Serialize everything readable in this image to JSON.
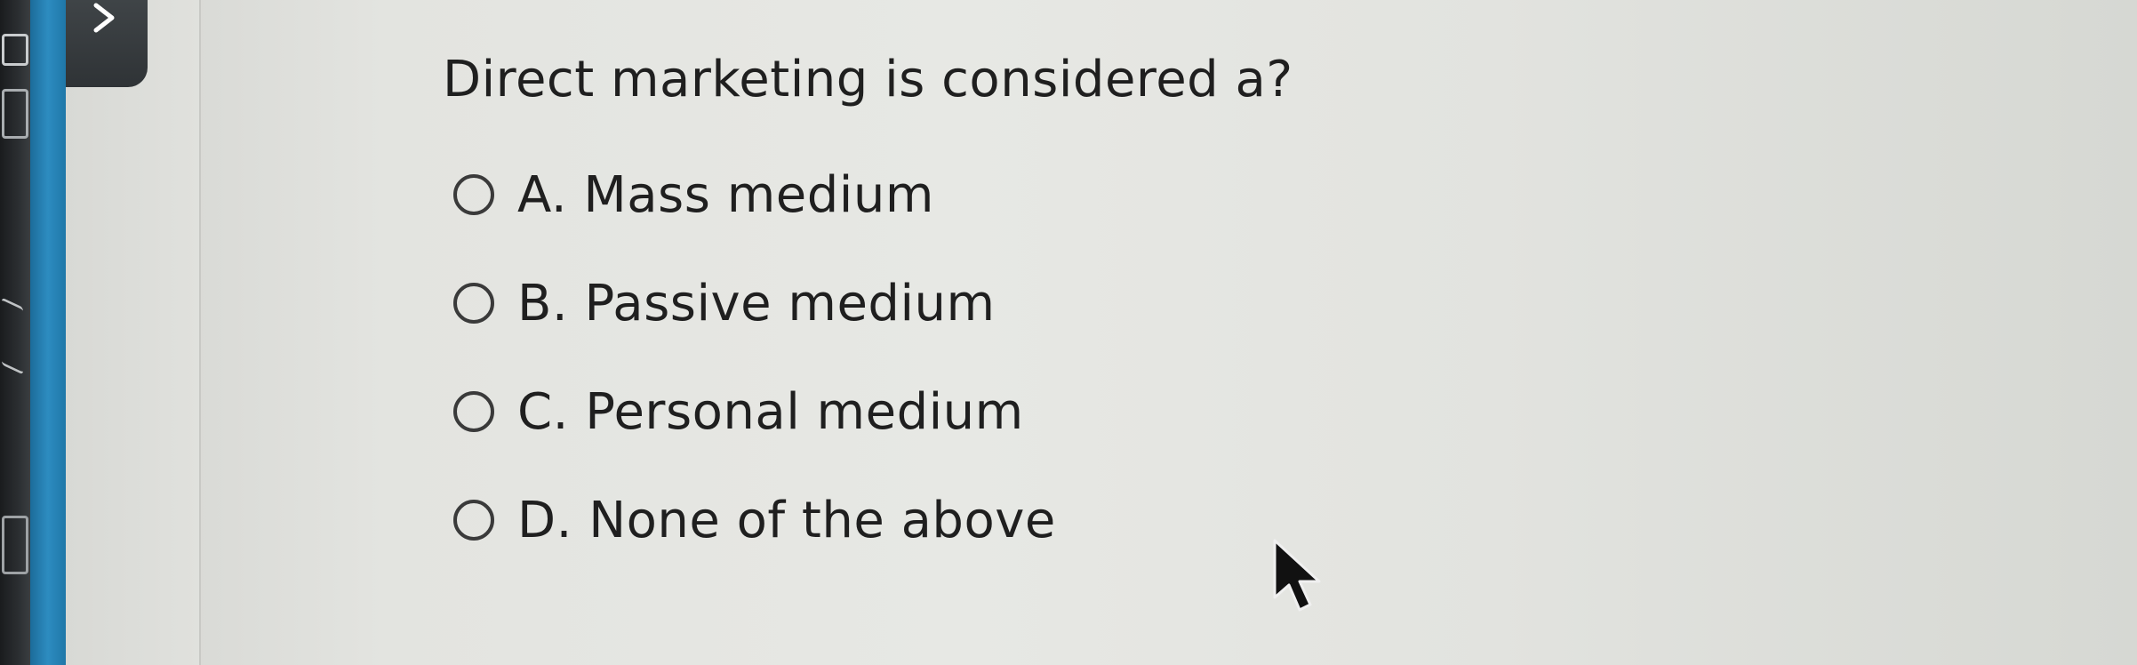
{
  "question": {
    "text": "Direct marketing is considered a?"
  },
  "options": [
    {
      "label": "A. Mass medium"
    },
    {
      "label": "B. Passive medium"
    },
    {
      "label": "C. Personal medium"
    },
    {
      "label": "D. None of the above"
    }
  ],
  "sidebar": {
    "toggle_icon": "chevron-right-icon"
  },
  "colors": {
    "accent_blue": "#2d8cc0",
    "text": "#1f1f1f",
    "background": "#e5e6e2"
  }
}
